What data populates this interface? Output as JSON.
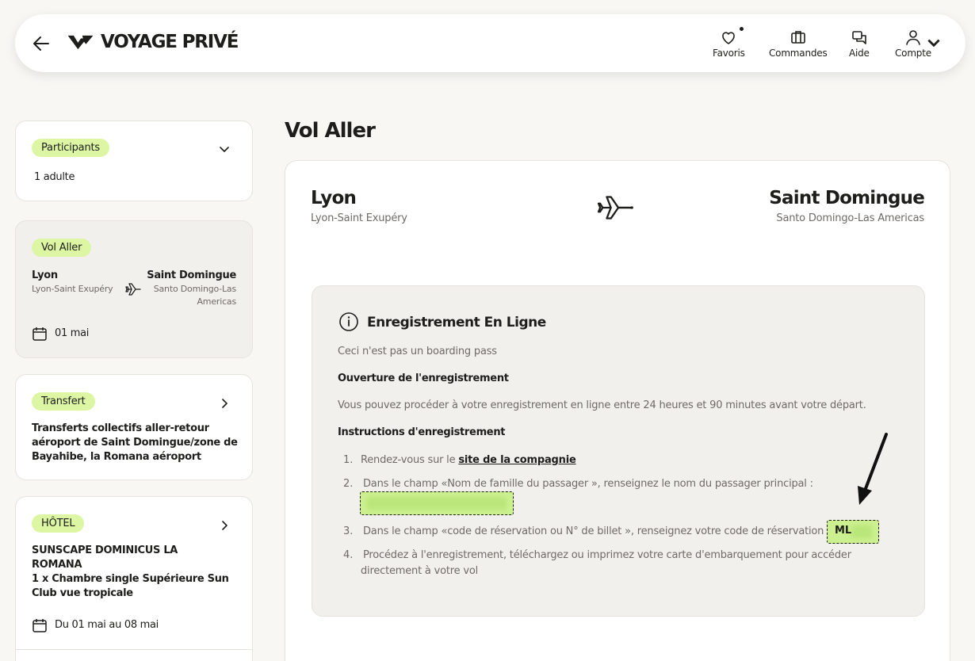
{
  "header": {
    "brand": "VOYAGE PRIVÉ",
    "nav": [
      {
        "label": "Favoris",
        "icon": "heart-icon"
      },
      {
        "label": "Commandes",
        "icon": "briefcase-icon"
      },
      {
        "label": "Aide",
        "icon": "chat-icon"
      },
      {
        "label": "Compte",
        "icon": "user-icon"
      }
    ]
  },
  "sidebar": {
    "participants": {
      "tag": "Participants",
      "value": "1 adulte"
    },
    "flight": {
      "tag": "Vol Aller",
      "from_city": "Lyon",
      "from_airport": "Lyon-Saint Exupéry",
      "to_city": "Saint Domingue",
      "to_airport_line1": "Santo Domingo-Las",
      "to_airport_line2": "Americas",
      "date": "01 mai"
    },
    "transfer": {
      "tag": "Transfert",
      "line1": "Transferts collectifs aller-retour",
      "line2": "aéroport de Saint Domingue/zone de",
      "line3": "Bayahibe, la Romana aéroport"
    },
    "hotel": {
      "tag": "HÔTEL",
      "line1": "SUNSCAPE DOMINICUS LA",
      "line2": "ROMANA",
      "line3": "1 x Chambre single Supérieure Sun",
      "line4": "Club vue tropicale",
      "dates": "Du 01 mai au 08 mai"
    }
  },
  "main": {
    "title": "Vol Aller",
    "from_city": "Lyon",
    "from_airport": "Lyon-Saint Exupéry",
    "to_city": "Saint Domingue",
    "to_airport": "Santo Domingo-Las Americas",
    "checkin": {
      "title": "Enregistrement En Ligne",
      "note": "Ceci n'est pas un boarding pass",
      "opening_heading": "Ouverture de l'enregistrement",
      "opening_text": "Vous pouvez procéder à votre enregistrement en ligne entre 24 heures et 90 minutes avant votre départ.",
      "instructions_heading": "Instructions d'enregistrement",
      "steps": [
        {
          "num": "1.",
          "text": "Rendez-vous sur le ",
          "link": "site de la compagnie"
        },
        {
          "num": "2.",
          "text": "Dans le champ «Nom de famille du passager », renseignez le nom du passager principal :"
        },
        {
          "num": "3.",
          "text": "Dans le champ «code de réservation ou N° de billet », renseignez votre code de réservation :"
        },
        {
          "num": "4.",
          "text_line1": "Procédez à l'enregistrement, téléchargez ou imprimez votre carte d'embarquement pour accéder",
          "text_line2": "directement à votre vol"
        }
      ],
      "booking_code_prefix": "ML"
    }
  },
  "colors": {
    "accent_pill": "#dcf6a4",
    "highlight": "#ccf08f",
    "background": "#f8f7f4"
  }
}
